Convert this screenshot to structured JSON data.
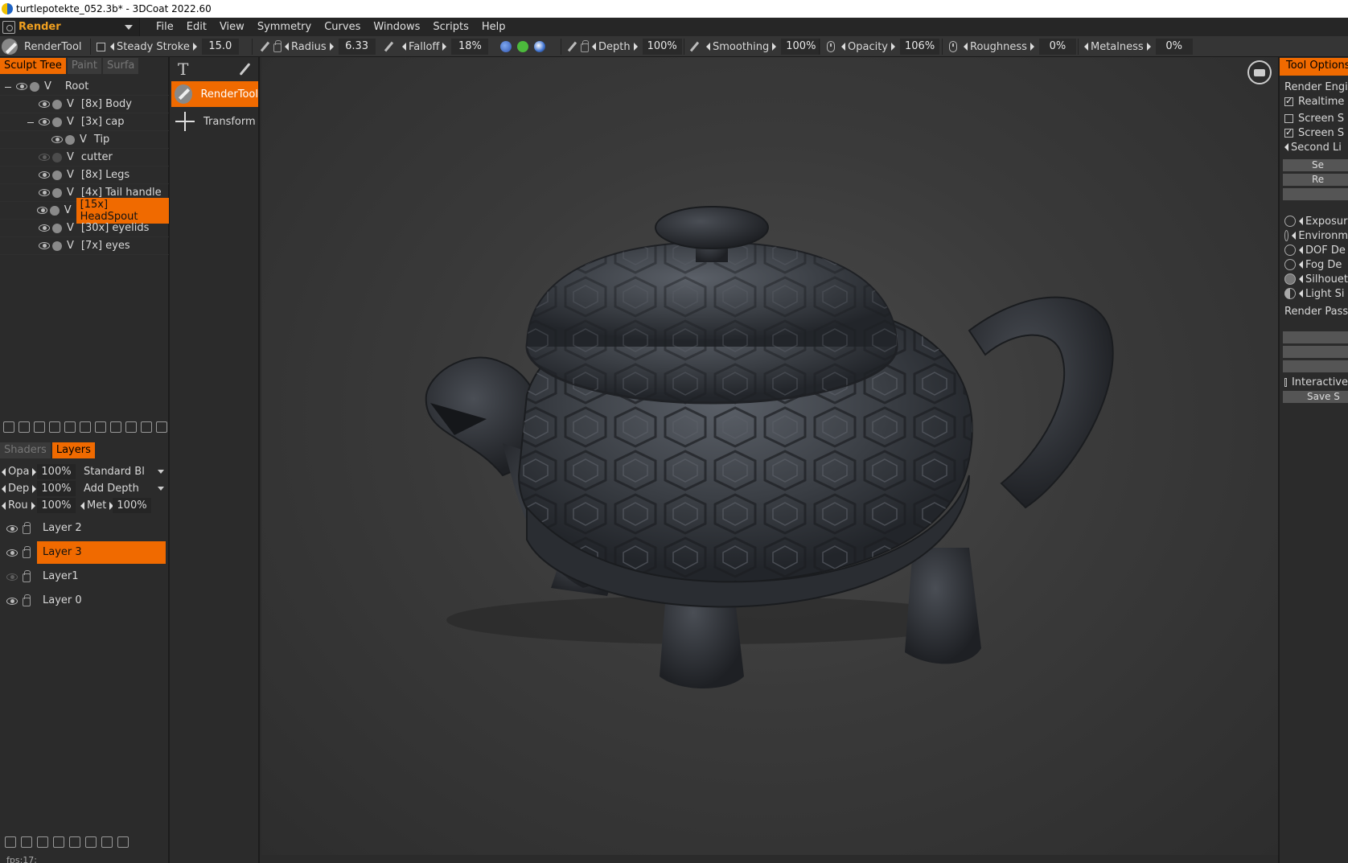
{
  "window": {
    "title": "turtlepotekte_052.3b* - 3DCoat 2022.60"
  },
  "room": {
    "label": "Render"
  },
  "menu": [
    "File",
    "Edit",
    "View",
    "Symmetry",
    "Curves",
    "Windows",
    "Scripts",
    "Help"
  ],
  "params": {
    "tool_name": "RenderTool",
    "steady_stroke": {
      "label": "Steady  Stroke",
      "value": "15.0",
      "checked": false
    },
    "radius": {
      "label": "Radius",
      "value": "6.33"
    },
    "falloff": {
      "label": "Falloff",
      "value": "18%"
    },
    "depth": {
      "label": "Depth",
      "value": "100%"
    },
    "smoothing": {
      "label": "Smoothing",
      "value": "100%"
    },
    "opacity": {
      "label": "Opacity",
      "value": "106%"
    },
    "roughness": {
      "label": "Roughness",
      "value": "0%"
    },
    "metalness": {
      "label": "Metalness",
      "value": "0%"
    }
  },
  "left_tabs": [
    "Sculpt  Tree",
    "Paint",
    "Surfa"
  ],
  "tree": {
    "root": "Root",
    "items": [
      {
        "label": "[8x]  Body"
      },
      {
        "label": "[3x]  cap"
      },
      {
        "label": "Tip"
      },
      {
        "label": "cutter"
      },
      {
        "label": "[8x]  Legs"
      },
      {
        "label": "[4x]  Tail  handle"
      },
      {
        "label": "[15x]  HeadSpout"
      },
      {
        "label": "[30x]  eyelids"
      },
      {
        "label": "[7x]  eyes"
      }
    ],
    "v_mark": "V"
  },
  "layer_tabs": [
    "Shaders",
    "Layers"
  ],
  "layer_props": {
    "opacity": {
      "label": "Opa",
      "value": "100%",
      "mode": "Standard  Bl"
    },
    "depth": {
      "label": "Dep",
      "value": "100%",
      "mode": "Add  Depth"
    },
    "rough": {
      "label": "Rou",
      "value": "100%",
      "met_label": "Met",
      "met_value": "100%"
    }
  },
  "layers": [
    {
      "name": "Layer  2"
    },
    {
      "name": "Layer  3"
    },
    {
      "name": "Layer1"
    },
    {
      "name": "Layer  0"
    }
  ],
  "fps": "fps:17;",
  "tools": {
    "render": "RenderTool",
    "transform": "Transform"
  },
  "right_panel": {
    "tab": "Tool  Options",
    "render_engine": "Render  Engine",
    "realtime": "Realtime",
    "screen1": "Screen  S",
    "screen2": "Screen  S",
    "second_light": "Second  Li",
    "btn1": "Se",
    "btn2": "Re",
    "exposure": "Exposur",
    "environment": "Environm",
    "dof": "DOF  De",
    "fog": "Fog  De",
    "silhouette": "Silhouet",
    "light": "Light  Si",
    "render_pass": "Render  Pass",
    "interactive": "Interactive",
    "save": "Save  S"
  },
  "colors": {
    "accent": "#f06a00",
    "brush_blue": "#3a6fcf",
    "brush_green": "#4cba3c"
  }
}
